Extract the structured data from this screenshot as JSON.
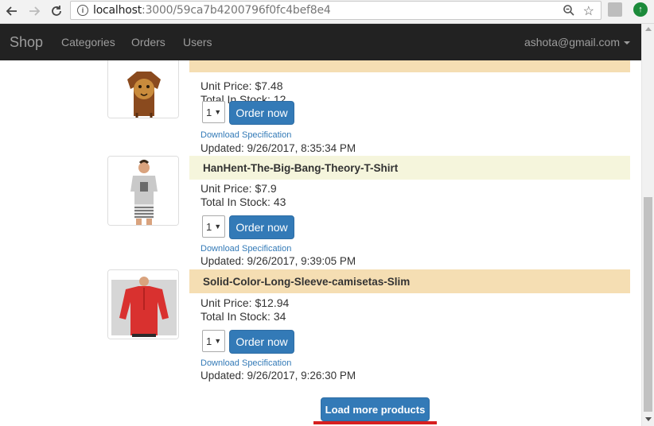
{
  "browser": {
    "url_host": "localhost",
    "url_path": ":3000/59ca7b4200796f0fc4bef8e4"
  },
  "navbar": {
    "brand": "Shop",
    "links": [
      "Categories",
      "Orders",
      "Users"
    ],
    "user": "ashota@gmail.com"
  },
  "products": [
    {
      "name": "",
      "unit_price": "Unit Price: $7.48",
      "stock": "Total In Stock: 12",
      "qty": "1",
      "order_label": "Order now",
      "download_label": "Download Specification",
      "updated": "Updated: 9/26/2017, 8:35:34 PM",
      "title_bg": "#f5deb3"
    },
    {
      "name": "HanHent-The-Big-Bang-Theory-T-Shirt",
      "unit_price": "Unit Price: $7.9",
      "stock": "Total In Stock: 43",
      "qty": "1",
      "order_label": "Order now",
      "download_label": "Download Specification",
      "updated": "Updated: 9/26/2017, 9:39:05 PM",
      "title_bg": "#f5f5dc"
    },
    {
      "name": "Solid-Color-Long-Sleeve-camisetas-Slim",
      "unit_price": "Unit Price: $12.94",
      "stock": "Total In Stock: 34",
      "qty": "1",
      "order_label": "Order now",
      "download_label": "Download Specification",
      "updated": "Updated: 9/26/2017, 9:26:30 PM",
      "title_bg": "#f5deb3"
    }
  ],
  "load_more_label": "Load more products",
  "colors": {
    "primary": "#337ab7",
    "navbar": "#222222",
    "highlight": "#d62021"
  }
}
